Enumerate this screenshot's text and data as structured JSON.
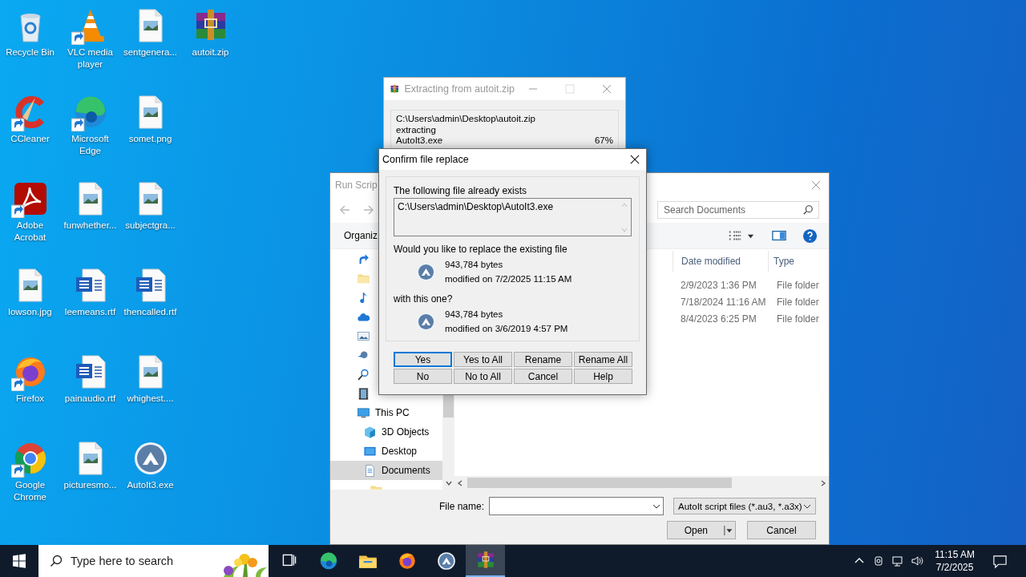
{
  "desktop_icons": [
    {
      "label": "Recycle Bin",
      "kind": "recycle",
      "shortcut": false
    },
    {
      "label": "CCleaner",
      "kind": "ccleaner",
      "shortcut": true
    },
    {
      "label": "Adobe Acrobat",
      "kind": "acrobat",
      "shortcut": true
    },
    {
      "label": "lowson.jpg",
      "shortcut": false
    },
    {
      "label": "Firefox",
      "kind": "firefox",
      "shortcut": true
    },
    {
      "label": "Google Chrome",
      "kind": "chrome",
      "shortcut": true
    },
    {
      "label": "VLC media player",
      "kind": "vlc",
      "shortcut": true
    },
    {
      "label": "Microsoft Edge",
      "kind": "edge",
      "shortcut": true
    },
    {
      "label": "funwhether...",
      "shortcut": false
    },
    {
      "label": "leemeans.rtf",
      "kind": "word",
      "shortcut": false
    },
    {
      "label": "painaudio.rtf",
      "kind": "word",
      "shortcut": false
    },
    {
      "label": "picturesmo...",
      "shortcut": false
    },
    {
      "label": "sentgenera...",
      "shortcut": false
    },
    {
      "label": "somet.png",
      "shortcut": false
    },
    {
      "label": "subjectgra...",
      "shortcut": false
    },
    {
      "label": "thencalled.rtf",
      "kind": "word",
      "shortcut": false
    },
    {
      "label": "whighest....",
      "shortcut": false
    },
    {
      "label": "AutoIt3.exe",
      "kind": "autoit",
      "shortcut": false
    },
    {
      "label": "autoit.zip",
      "kind": "archive",
      "shortcut": false
    }
  ],
  "extract_window": {
    "title": "Extracting from autoit.zip",
    "archive_path": "C:\\Users\\admin\\Desktop\\autoit.zip",
    "action": "extracting",
    "file": "AutoIt3.exe",
    "percent": "67%"
  },
  "open_dialog": {
    "title": "Run Scrip",
    "toolbar_label": "Organiz",
    "search": {
      "placeholder": "Search Documents"
    },
    "nav_items": [
      {
        "kind": "quick",
        "selected": false
      },
      {
        "kind": "folder",
        "selected": false
      },
      {
        "kind": "music",
        "selected": false
      },
      {
        "kind": "cloud",
        "selected": false
      },
      {
        "kind": "pictures",
        "selected": false
      },
      {
        "kind": "network",
        "selected": false
      },
      {
        "kind": "search",
        "selected": false
      },
      {
        "kind": "video",
        "selected": false
      },
      {
        "kind": "pc",
        "label": "This PC",
        "selected": false,
        "children": [
          {
            "kind": "cube",
            "label": "3D Objects",
            "selected": false
          },
          {
            "kind": "desktop",
            "label": "Desktop",
            "selected": false
          },
          {
            "kind": "docs",
            "label": "Documents",
            "selected": true,
            "children": [
              {
                "kind": "folder",
                "selected": false
              }
            ]
          }
        ]
      }
    ],
    "columns": [
      "Date modified",
      "Type"
    ],
    "rows": [
      {
        "date": "2/9/2023 1:36 PM",
        "type": "File folder"
      },
      {
        "date": "7/18/2024 11:16 AM",
        "type": "File folder"
      },
      {
        "date": "8/4/2023 6:25 PM",
        "type": "File folder"
      }
    ],
    "file_name_label": "File name:",
    "file_type": "AutoIt script files (*.au3, *.a3x)",
    "buttons": [
      "Open",
      "Cancel"
    ]
  },
  "confirm_dialog": {
    "title": "Confirm file replace",
    "intro": "The following file already exists",
    "path": "C:\\Users\\admin\\Desktop\\AutoIt3.exe",
    "question": "Would you like to replace the existing file",
    "existing": {
      "size": "943,784 bytes",
      "modified": "modified on 7/2/2025 11:15 AM"
    },
    "with_label": "with this one?",
    "replacement": {
      "size": "943,784 bytes",
      "modified": "modified on 3/6/2019 4:57 PM"
    },
    "buttons": [
      {
        "label": "Yes",
        "selected": true
      },
      {
        "label": "Yes to All",
        "selected": false
      },
      {
        "label": "Rename",
        "selected": false
      },
      {
        "label": "Rename All",
        "selected": false
      },
      {
        "label": "No",
        "selected": false
      },
      {
        "label": "No to All",
        "selected": false
      },
      {
        "label": "Cancel",
        "selected": false
      },
      {
        "label": "Help",
        "selected": false
      }
    ]
  },
  "taskbar": {
    "search_placeholder": "Type here to search",
    "apps": [
      {
        "kind": "taskview",
        "active": false
      },
      {
        "kind": "edge",
        "active": false
      },
      {
        "kind": "explorer",
        "active": false
      },
      {
        "kind": "firefox",
        "active": false
      },
      {
        "kind": "autoit",
        "active": false
      },
      {
        "kind": "archive",
        "active": true
      }
    ],
    "time": "11:15 AM",
    "date": "7/2/2025"
  }
}
